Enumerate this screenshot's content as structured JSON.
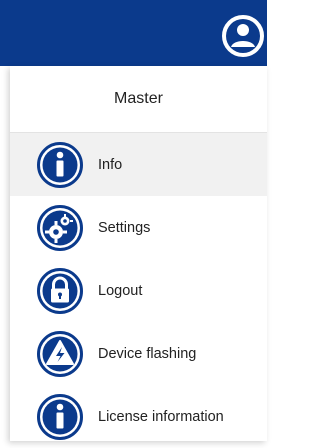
{
  "header": {
    "account_label": "Master",
    "user_icon": "user-avatar-icon",
    "brand_color": "#0b3a8c"
  },
  "menu": {
    "items": [
      {
        "label": "Info",
        "icon": "info-icon",
        "active": true
      },
      {
        "label": "Settings",
        "icon": "settings-gears-icon",
        "active": false
      },
      {
        "label": "Logout",
        "icon": "lock-icon",
        "active": false
      },
      {
        "label": "Device flashing",
        "icon": "flash-warning-icon",
        "active": false
      },
      {
        "label": "License information",
        "icon": "info-icon",
        "active": false
      }
    ]
  },
  "colors": {
    "icon": "#0b3a8c",
    "active_row": "#f1f1f1"
  }
}
